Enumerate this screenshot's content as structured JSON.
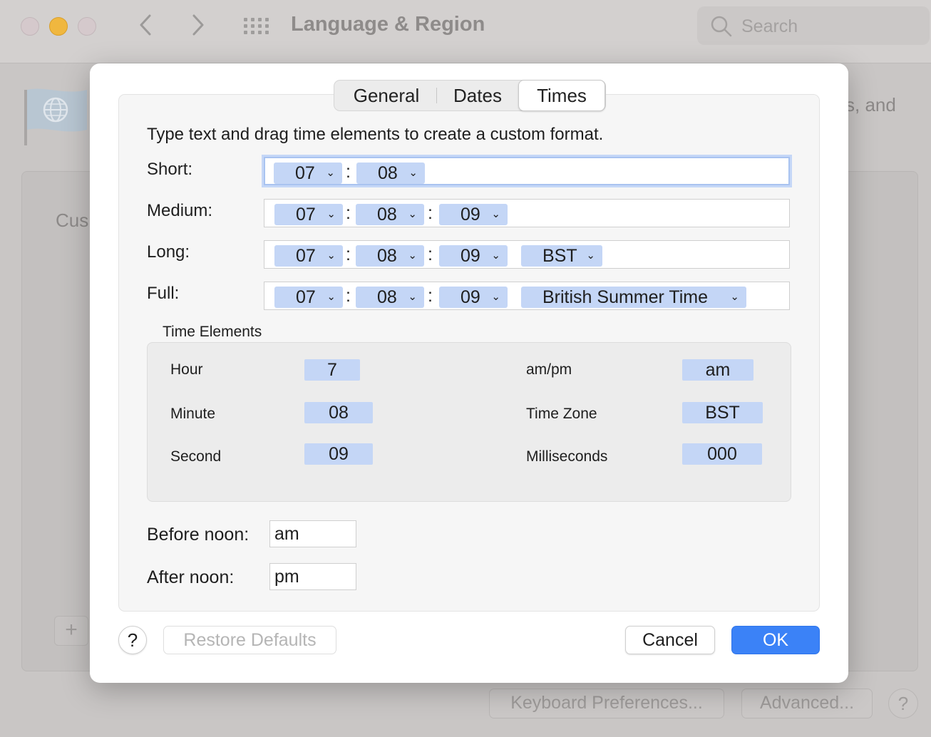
{
  "window": {
    "title": "Language & Region",
    "search_placeholder": "Search",
    "bg_text_right": "s, and",
    "bg_text_left": "Cus",
    "add_label": "+",
    "keyboard_prefs_label": "Keyboard Preferences...",
    "advanced_label": "Advanced...",
    "help_label": "?"
  },
  "sheet": {
    "tabs": [
      {
        "label": "General",
        "selected": false
      },
      {
        "label": "Dates",
        "selected": false
      },
      {
        "label": "Times",
        "selected": true
      }
    ],
    "instruction": "Type text and drag time elements to create a custom format.",
    "formats": {
      "short": {
        "label": "Short:",
        "hour": "07",
        "minute": "08"
      },
      "medium": {
        "label": "Medium:",
        "hour": "07",
        "minute": "08",
        "second": "09"
      },
      "long": {
        "label": "Long:",
        "hour": "07",
        "minute": "08",
        "second": "09",
        "zone": "BST"
      },
      "full": {
        "label": "Full:",
        "hour": "07",
        "minute": "08",
        "second": "09",
        "zone": "British Summer Time"
      }
    },
    "separator": ":",
    "time_elements": {
      "title": "Time Elements",
      "hour": {
        "label": "Hour",
        "value": "7"
      },
      "minute": {
        "label": "Minute",
        "value": "08"
      },
      "second": {
        "label": "Second",
        "value": "09"
      },
      "ampm": {
        "label": "am/pm",
        "value": "am"
      },
      "timezone": {
        "label": "Time Zone",
        "value": "BST"
      },
      "milliseconds": {
        "label": "Milliseconds",
        "value": "000"
      }
    },
    "before_noon": {
      "label": "Before noon:",
      "value": "am"
    },
    "after_noon": {
      "label": "After noon:",
      "value": "pm"
    },
    "help_label": "?",
    "restore_label": "Restore Defaults",
    "cancel_label": "Cancel",
    "ok_label": "OK"
  },
  "colors": {
    "token": "#c4d6f6",
    "accent": "#3b82f7",
    "traffic_min": "#f0b73f"
  }
}
